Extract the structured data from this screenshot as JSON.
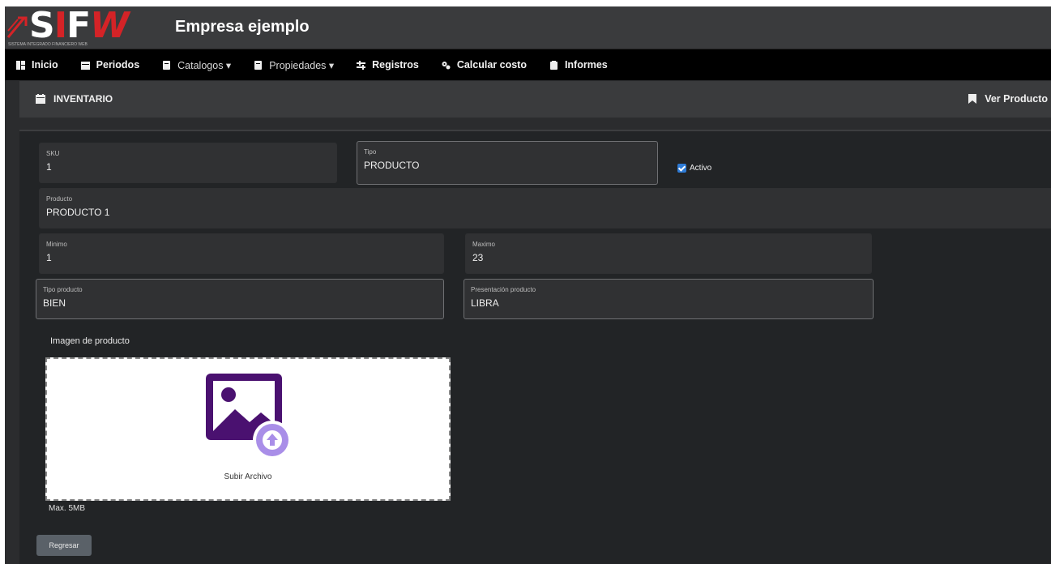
{
  "header": {
    "logo_text": "SIFW",
    "logo_tagline": "SISTEMA INTEGRADO FINANCIERO WEB",
    "company": "Empresa ejemplo"
  },
  "nav": {
    "items": [
      {
        "label": "Inicio",
        "icon": "dashboard-icon"
      },
      {
        "label": "Periodos",
        "icon": "calendar-icon"
      },
      {
        "label": "Catalogos ▾",
        "icon": "book-icon"
      },
      {
        "label": "Propiedades ▾",
        "icon": "book-icon"
      },
      {
        "label": "Registros",
        "icon": "sliders-icon"
      },
      {
        "label": "Calcular costo",
        "icon": "gears-icon"
      },
      {
        "label": "Informes",
        "icon": "clipboard-icon"
      }
    ]
  },
  "subheader": {
    "title": "INVENTARIO",
    "action": "Ver Producto"
  },
  "form": {
    "sku": {
      "label": "SKU",
      "value": "1"
    },
    "tipo": {
      "label": "Tipo",
      "value": "PRODUCTO"
    },
    "activo": {
      "label": "Activo",
      "checked": true
    },
    "producto": {
      "label": "Producto",
      "value": "PRODUCTO 1"
    },
    "minimo": {
      "label": "Minimo",
      "value": "1"
    },
    "maximo": {
      "label": "Maximo",
      "value": "23"
    },
    "tipo_producto": {
      "label": "Tipo producto",
      "value": "BIEN"
    },
    "presentacion": {
      "label": "Presentación producto",
      "value": "LIBRA"
    }
  },
  "image_upload": {
    "label": "Imagen de producto",
    "button_text": "Subir Archivo",
    "max_size": "Max. 5MB"
  },
  "actions": {
    "back": "Regresar"
  },
  "colors": {
    "brand_red": "#d42327",
    "upload_purple": "#4a1170",
    "upload_light_purple": "#a98ee8",
    "checkbox_blue": "#2e7bd6"
  }
}
